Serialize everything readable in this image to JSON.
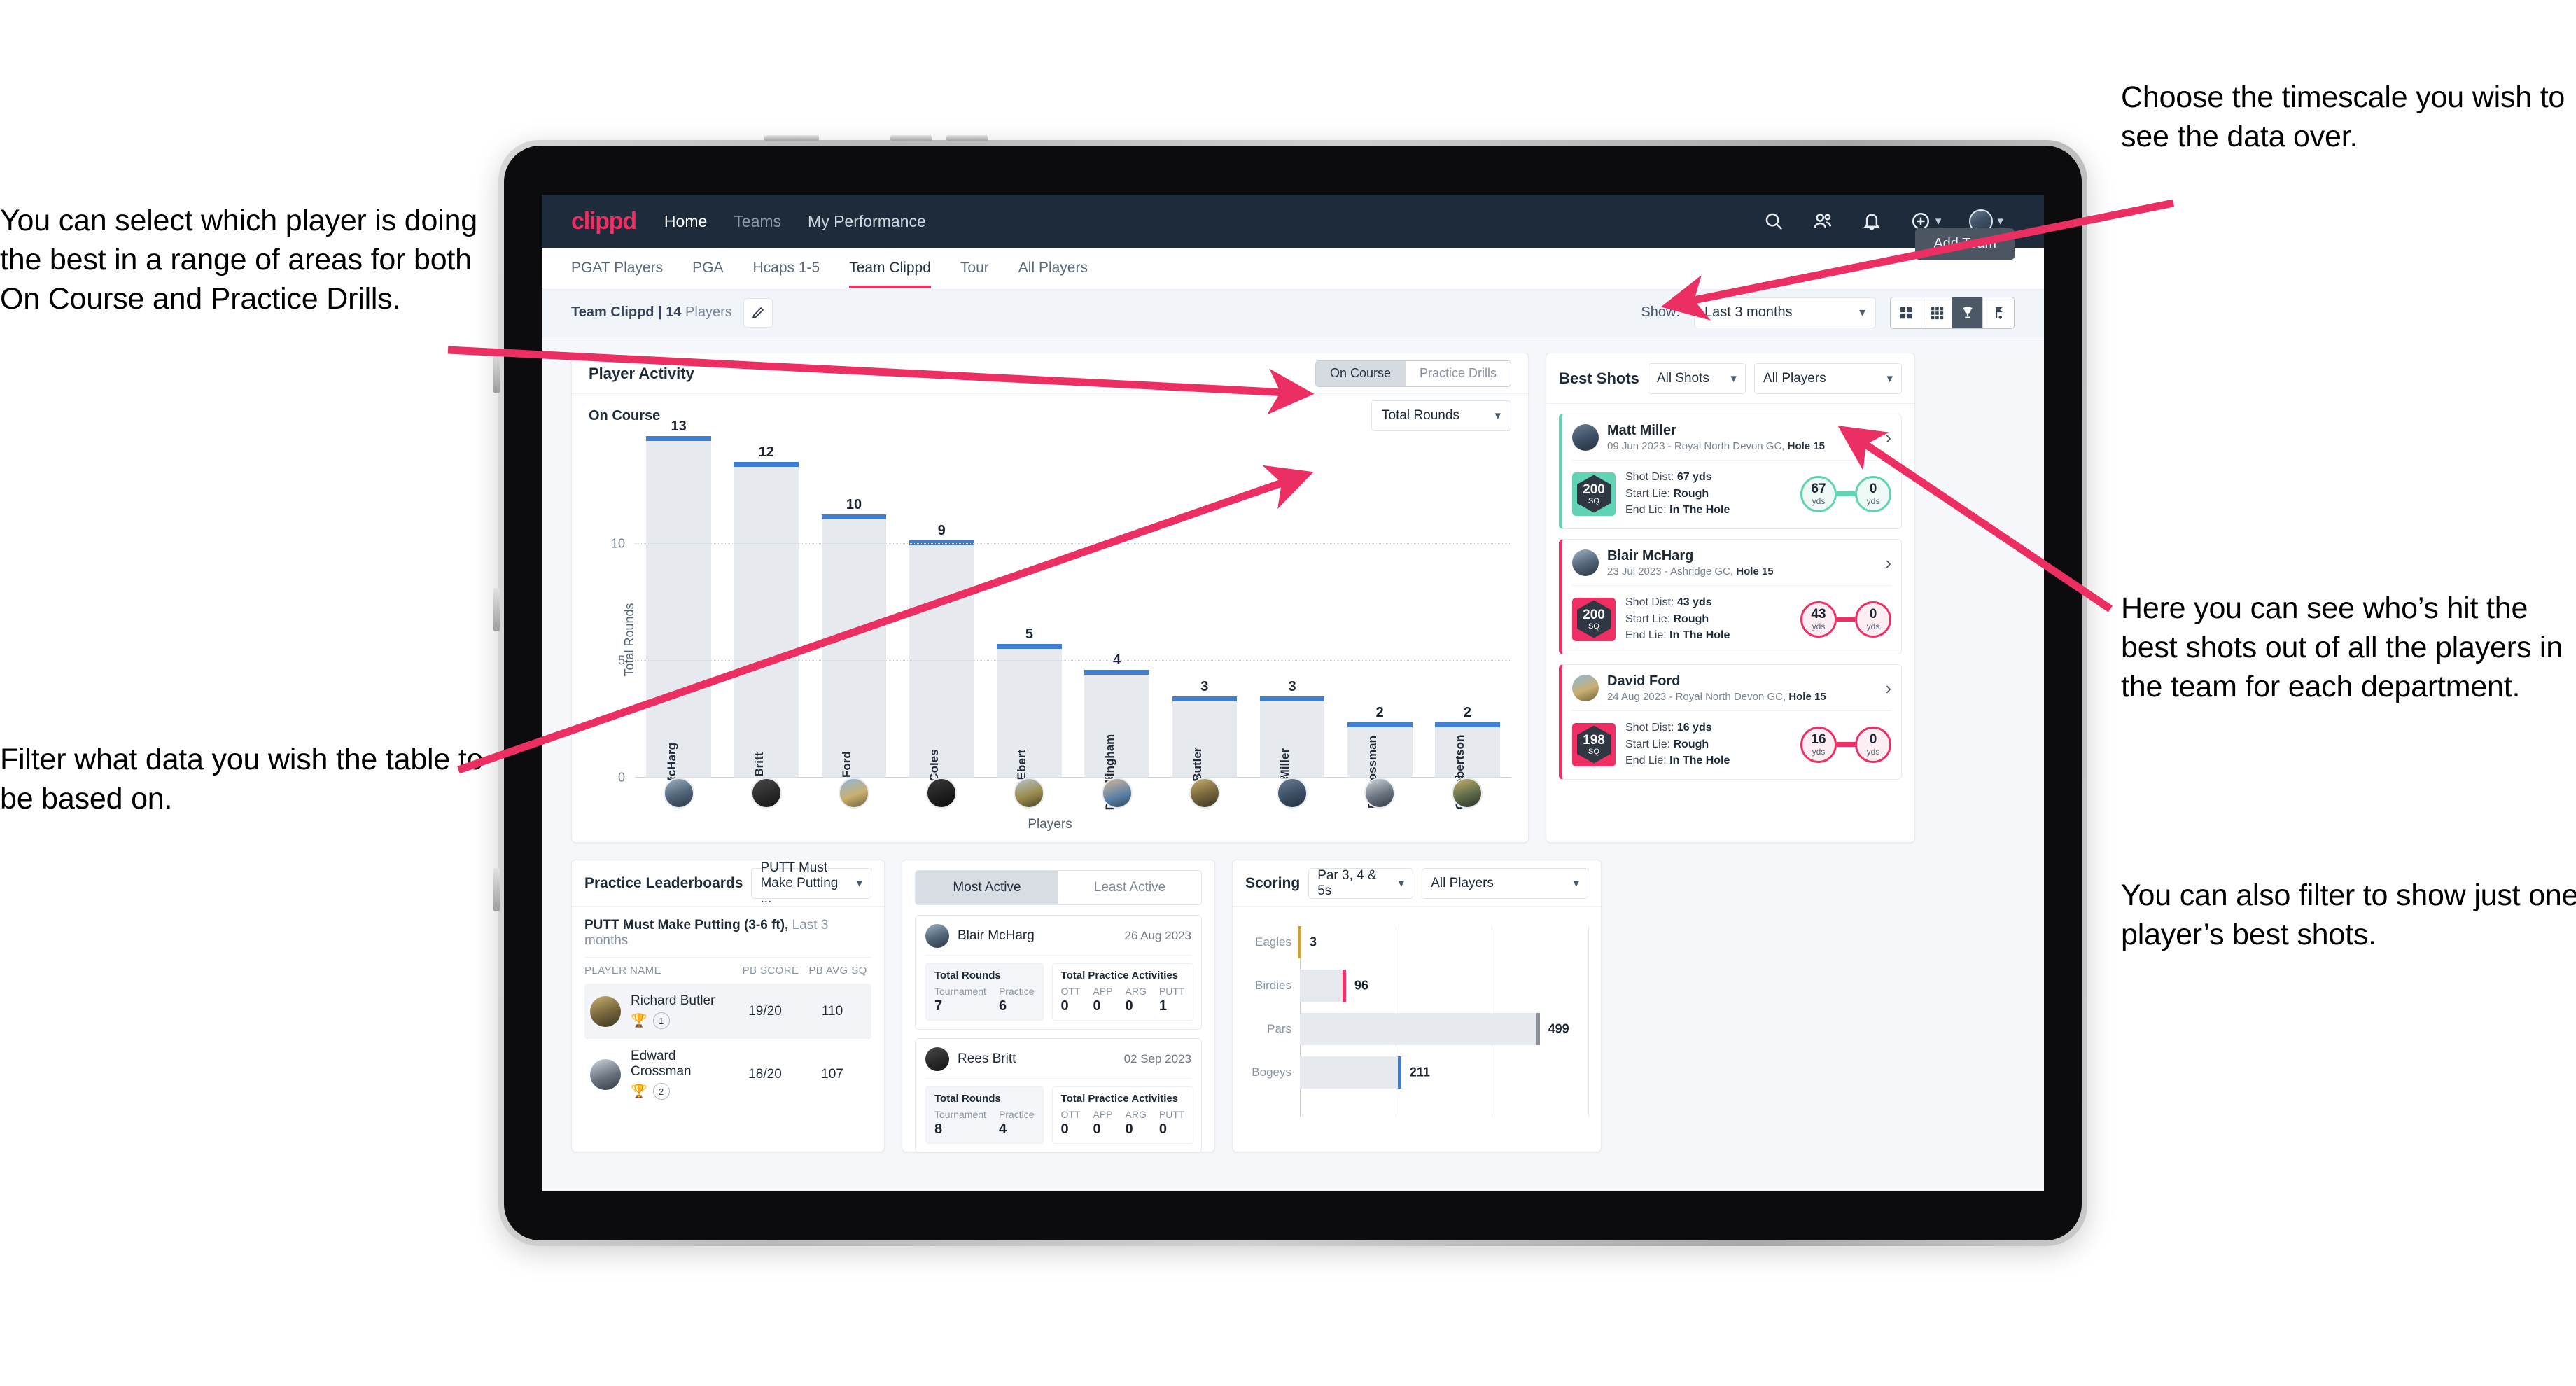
{
  "annotations": {
    "left_top": "You can select which player is doing the best in a range of areas for both On Course and Practice Drills.",
    "left_bottom": "Filter what data you wish the table to be based on.",
    "right_top": "Choose the timescale you wish to see the data over.",
    "right_middle": "Here you can see who’s hit the best shots out of all the players in the team for each department.",
    "right_bottom": "You can also filter to show just one player’s best shots."
  },
  "app": {
    "logo": "clippd",
    "nav": [
      {
        "label": "Home",
        "state": "active"
      },
      {
        "label": "Teams",
        "state": "dim"
      },
      {
        "label": "My Performance",
        "state": "normal"
      }
    ],
    "header_icons": [
      "search-icon",
      "people-icon",
      "bell-icon",
      "plus-circle-icon",
      "avatar"
    ],
    "tooltip": "Add Team"
  },
  "tabs": [
    {
      "label": "PGAT Players",
      "active": false
    },
    {
      "label": "PGA",
      "active": false
    },
    {
      "label": "Hcaps 1-5",
      "active": false
    },
    {
      "label": "Team Clippd",
      "active": true
    },
    {
      "label": "Tour",
      "active": false
    },
    {
      "label": "All Players",
      "active": false
    }
  ],
  "subbar": {
    "team_name": "Team Clippd",
    "separator": "|",
    "player_count": "14",
    "players_word": "Players",
    "show_label": "Show:",
    "timescale_value": "Last 3 months",
    "view_icons": [
      "grid-large-icon",
      "grid-small-icon",
      "trophy-icon",
      "flag-icon"
    ],
    "active_view": "trophy-icon"
  },
  "player_activity": {
    "title": "Player Activity",
    "segments": [
      {
        "label": "On Course",
        "active": true
      },
      {
        "label": "Practice Drills",
        "active": false
      }
    ],
    "subtitle": "On Course",
    "metric_select": "Total Rounds"
  },
  "best_shots": {
    "title": "Best Shots",
    "filter_shots": "All Shots",
    "filter_players": "All Players",
    "cards": [
      {
        "name": "Matt Miller",
        "meta_date": "09 Jun 2023",
        "meta_course": "Royal North Devon GC,",
        "meta_hole": "Hole 15",
        "badge_value": "200",
        "badge_unit": "SQ",
        "accent": "#5fd3b3",
        "theme": "teal",
        "shot_dist_label": "Shot Dist:",
        "shot_dist_value": "67 yds",
        "start_lie_label": "Start Lie:",
        "start_lie_value": "Rough",
        "end_lie_label": "End Lie:",
        "end_lie_value": "In The Hole",
        "from_value": "67",
        "from_unit": "yds",
        "to_value": "0",
        "to_unit": "yds"
      },
      {
        "name": "Blair McHarg",
        "meta_date": "23 Jul 2023",
        "meta_course": "Ashridge GC,",
        "meta_hole": "Hole 15",
        "badge_value": "200",
        "badge_unit": "SQ",
        "accent": "#ef2e63",
        "theme": "pink",
        "shot_dist_label": "Shot Dist:",
        "shot_dist_value": "43 yds",
        "start_lie_label": "Start Lie:",
        "start_lie_value": "Rough",
        "end_lie_label": "End Lie:",
        "end_lie_value": "In The Hole",
        "from_value": "43",
        "from_unit": "yds",
        "to_value": "0",
        "to_unit": "yds"
      },
      {
        "name": "David Ford",
        "meta_date": "24 Aug 2023",
        "meta_course": "Royal North Devon GC,",
        "meta_hole": "Hole 15",
        "badge_value": "198",
        "badge_unit": "SQ",
        "accent": "#ef2e63",
        "theme": "pink",
        "shot_dist_label": "Shot Dist:",
        "shot_dist_value": "16 yds",
        "start_lie_label": "Start Lie:",
        "start_lie_value": "Rough",
        "end_lie_label": "End Lie:",
        "end_lie_value": "In The Hole",
        "from_value": "16",
        "from_unit": "yds",
        "to_value": "0",
        "to_unit": "yds"
      }
    ]
  },
  "practice_leaderboards": {
    "title": "Practice Leaderboards",
    "drill_select": "PUTT Must Make Putting ...",
    "subtitle_bold": "PUTT Must Make Putting (3-6 ft),",
    "subtitle_light": "Last 3 months",
    "columns": [
      "PLAYER NAME",
      "PB SCORE",
      "PB AVG SQ"
    ],
    "rows": [
      {
        "name": "Richard Butler",
        "rank": "1",
        "trophy": "gold",
        "pb_score": "19/20",
        "pb_avg_sq": "110",
        "highlight": true
      },
      {
        "name": "Edward Crossman",
        "rank": "2",
        "trophy": "silver",
        "pb_score": "18/20",
        "pb_avg_sq": "107",
        "highlight": false
      }
    ]
  },
  "activity_panel": {
    "tabs": [
      {
        "label": "Most Active",
        "active": true
      },
      {
        "label": "Least Active",
        "active": false
      }
    ],
    "rounds_title": "Total Rounds",
    "rounds_cols": [
      "Tournament",
      "Practice"
    ],
    "practice_title": "Total Practice Activities",
    "practice_cols": [
      "OTT",
      "APP",
      "ARG",
      "PUTT"
    ],
    "cards": [
      {
        "name": "Blair McHarg",
        "date": "26 Aug 2023",
        "rounds": [
          "7",
          "6"
        ],
        "practice": [
          "0",
          "0",
          "0",
          "1"
        ]
      },
      {
        "name": "Rees Britt",
        "date": "02 Sep 2023",
        "rounds": [
          "8",
          "4"
        ],
        "practice": [
          "0",
          "0",
          "0",
          "0"
        ]
      }
    ]
  },
  "scoring": {
    "title": "Scoring",
    "filter_par": "Par 3, 4 & 5s",
    "filter_players": "All Players"
  },
  "chart_data": [
    {
      "type": "bar",
      "title": "Player Activity - On Course",
      "xlabel": "Players",
      "ylabel": "Total Rounds",
      "ylim": [
        0,
        14
      ],
      "yticks": [
        0,
        5,
        10
      ],
      "grid": true,
      "bar_color": "#e6e9ee",
      "cap_color": "#3e7fd4",
      "categories": [
        "B. McHarg",
        "R. Britt",
        "D. Ford",
        "J. Coles",
        "E. Ebert",
        "D. Billingham",
        "R. Butler",
        "M. Miller",
        "E. Crossman",
        "C. Robertson"
      ],
      "values": [
        13,
        12,
        10,
        9,
        5,
        4,
        3,
        3,
        2,
        2
      ]
    },
    {
      "type": "bar",
      "orientation": "horizontal",
      "title": "Scoring",
      "xlabel": "",
      "ylabel": "",
      "xlim": [
        0,
        600
      ],
      "grid": true,
      "categories": [
        "Eagles",
        "Birdies",
        "Pars",
        "Bogeys"
      ],
      "values": [
        3,
        96,
        499,
        211
      ],
      "cap_colors": [
        "#c7a149",
        "#ef2e63",
        "#8a919b",
        "#3e7fd4"
      ]
    }
  ]
}
